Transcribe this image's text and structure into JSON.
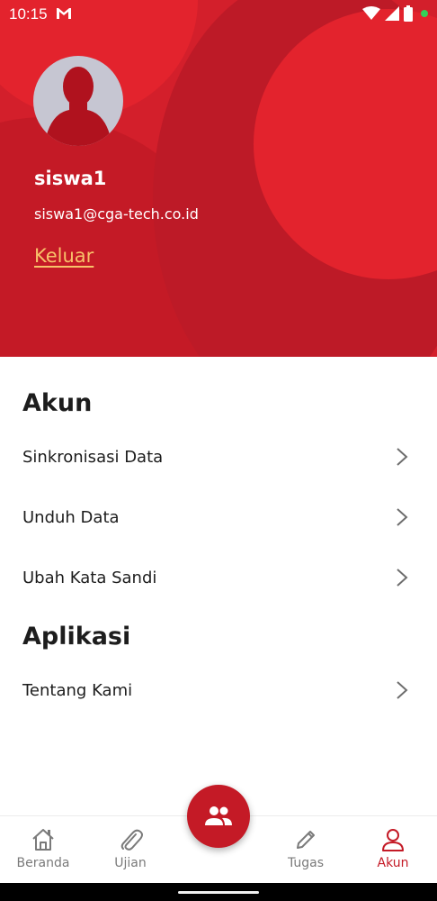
{
  "status_bar": {
    "time": "10:15"
  },
  "profile": {
    "username": "siswa1",
    "email": "siswa1@cga-tech.co.id",
    "logout_label": "Keluar"
  },
  "sections": {
    "account": {
      "title": "Akun",
      "items": [
        {
          "label": "Sinkronisasi Data"
        },
        {
          "label": "Unduh Data"
        },
        {
          "label": "Ubah Kata Sandi"
        }
      ]
    },
    "application": {
      "title": "Aplikasi",
      "items": [
        {
          "label": "Tentang Kami"
        }
      ]
    }
  },
  "bottom_nav": {
    "items": [
      {
        "label": "Beranda",
        "icon": "home-icon"
      },
      {
        "label": "Ujian",
        "icon": "paperclip-icon"
      },
      {
        "label": "Tugas",
        "icon": "pencil-icon"
      },
      {
        "label": "Akun",
        "icon": "person-icon"
      }
    ],
    "active": "Akun",
    "fab_icon": "group-icon"
  },
  "colors": {
    "brand_red": "#d31f2b",
    "accent_dark_red": "#c41a26",
    "logout_link": "#f8c26a",
    "nav_inactive": "#7a7a7a"
  }
}
